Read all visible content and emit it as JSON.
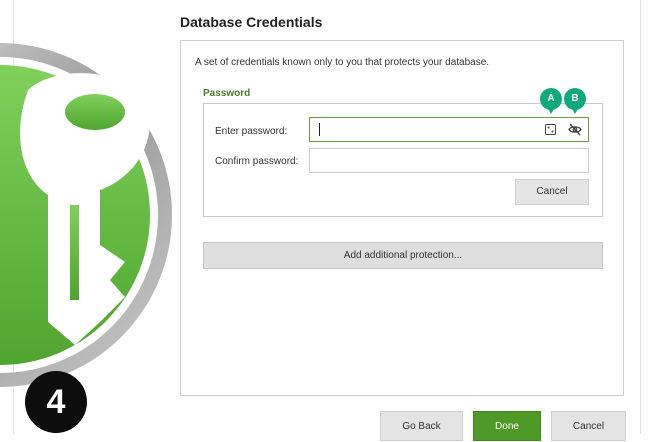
{
  "dialog": {
    "title": "Database Credentials",
    "description": "A set of credentials known only to you that protects your database."
  },
  "password_group": {
    "title": "Password",
    "enter_label": "Enter password:",
    "confirm_label": "Confirm password:",
    "enter_value": "",
    "confirm_value": "",
    "cancel_label": "Cancel"
  },
  "add_protection_label": "Add additional protection...",
  "markers": {
    "a": "A",
    "b": "B"
  },
  "step_number": "4",
  "footer": {
    "go_back_label": "Go Back",
    "done_label": "Done",
    "cancel_label": "Cancel"
  },
  "colors": {
    "accent_green": "#4f9a27",
    "section_title_green": "#4a7a2c",
    "marker_teal": "#10a97a",
    "logo_green": "#6cc24a"
  },
  "icons": {
    "generator": "password-generator-icon",
    "visibility": "eye-slash-icon",
    "logo": "keepassxc-key-logo"
  }
}
